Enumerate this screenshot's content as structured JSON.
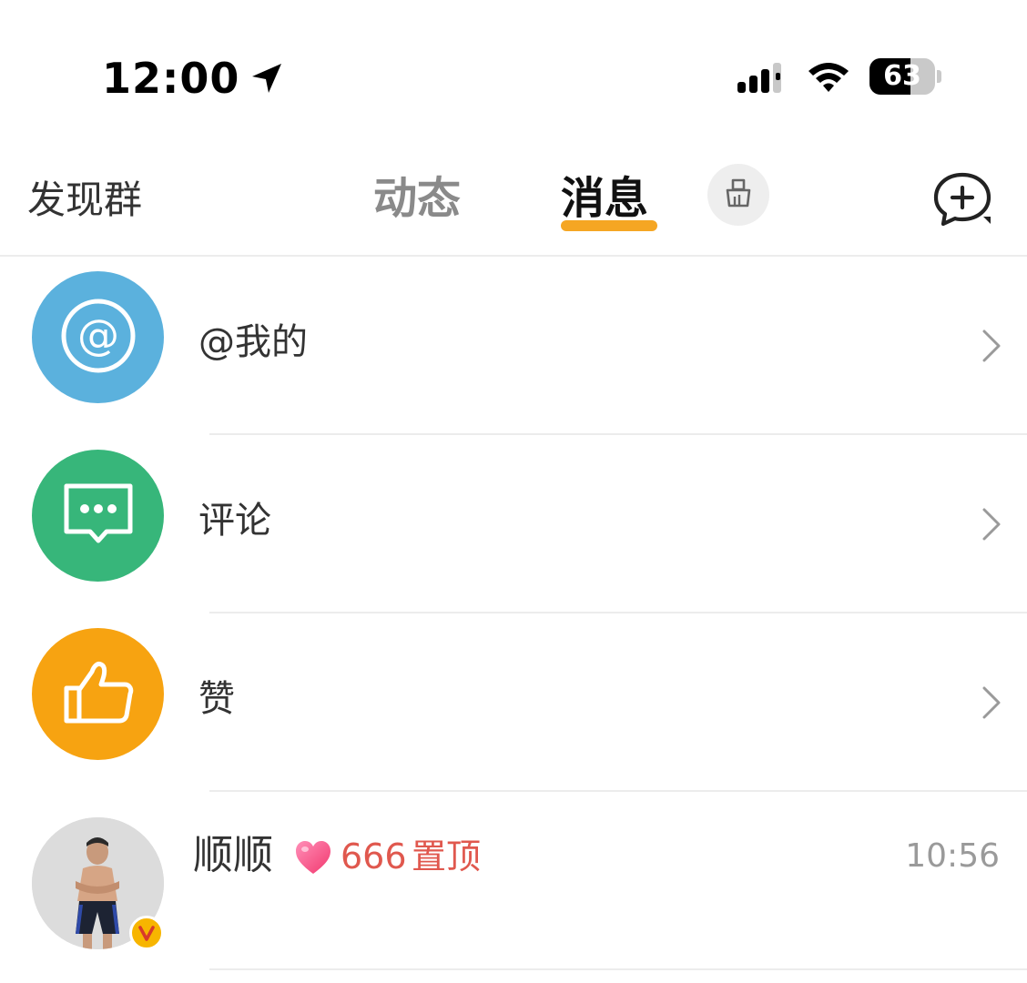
{
  "status_bar": {
    "time": "12:00",
    "battery_level": "63",
    "battery_fraction": 0.63
  },
  "header": {
    "left_link": "发现群",
    "tabs": [
      {
        "label": "动态",
        "active": false
      },
      {
        "label": "消息",
        "active": true
      }
    ],
    "accent_color": "#f5a623",
    "icons": {
      "clear": "broom-icon",
      "new_chat": "add-chat-icon"
    }
  },
  "entries": [
    {
      "label": "@我的",
      "icon": "at-icon",
      "color": "#5bb1dd"
    },
    {
      "label": "评论",
      "icon": "comment-icon",
      "color": "#37b67a"
    },
    {
      "label": "赞",
      "icon": "thumbs-up-icon",
      "color": "#f7a311"
    }
  ],
  "contact": {
    "name": "顺顺",
    "heart_count": "666",
    "pinned_label": "置顶",
    "time": "10:56",
    "verified": true,
    "badge_color": "#f7b500",
    "highlight_color": "#e0584e"
  }
}
